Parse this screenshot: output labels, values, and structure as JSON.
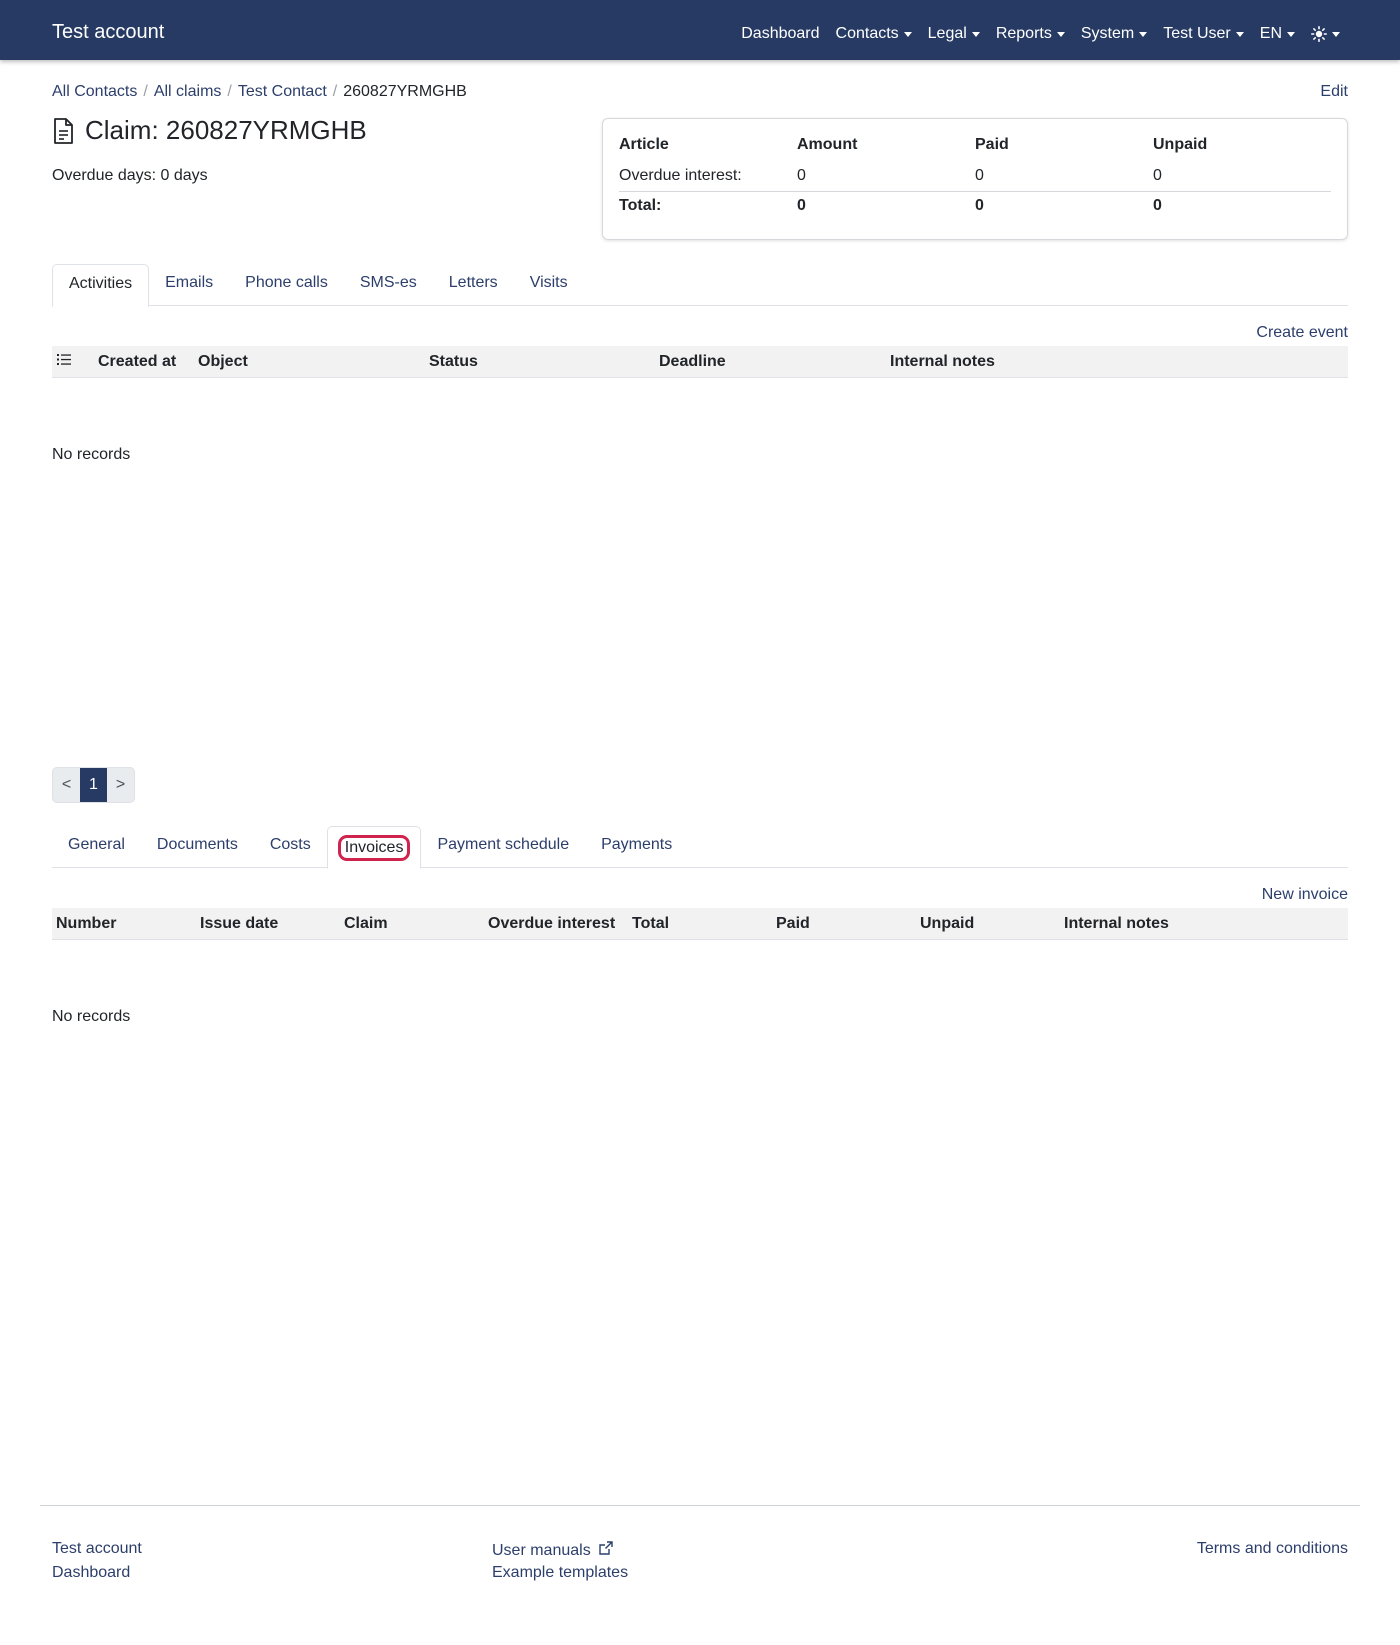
{
  "navbar": {
    "brand": "Test account",
    "items": [
      {
        "label": "Dashboard",
        "dropdown": false
      },
      {
        "label": "Contacts",
        "dropdown": true
      },
      {
        "label": "Legal",
        "dropdown": true
      },
      {
        "label": "Reports",
        "dropdown": true
      },
      {
        "label": "System",
        "dropdown": true
      },
      {
        "label": "Test User",
        "dropdown": true
      },
      {
        "label": "EN",
        "dropdown": true
      }
    ],
    "theme_icon": "sun-icon"
  },
  "breadcrumb": {
    "items": [
      "All Contacts",
      "All claims",
      "Test Contact"
    ],
    "active": "260827YRMGHB"
  },
  "edit_label": "Edit",
  "title": "Claim: 260827YRMGHB",
  "title_icon": "document-icon",
  "overdue_text": "Overdue days: 0 days",
  "summary": {
    "headers": [
      "Article",
      "Amount",
      "Paid",
      "Unpaid"
    ],
    "rows": [
      [
        "Overdue interest:",
        "0",
        "0",
        "0"
      ]
    ],
    "total": [
      "Total:",
      "0",
      "0",
      "0"
    ]
  },
  "activity_tabs": {
    "items": [
      "Activities",
      "Emails",
      "Phone calls",
      "SMS-es",
      "Letters",
      "Visits"
    ],
    "active": "Activities"
  },
  "activities": {
    "action": "Create event",
    "columns": [
      "Created at",
      "Object",
      "Status",
      "Deadline",
      "Internal notes"
    ],
    "empty": "No records",
    "list_icon": "list-icon"
  },
  "pagination": {
    "prev": "<",
    "current": "1",
    "next": ">"
  },
  "claim_tabs": {
    "items": [
      "General",
      "Documents",
      "Costs",
      "Invoices",
      "Payment schedule",
      "Payments"
    ],
    "active": "Invoices"
  },
  "invoices": {
    "action": "New invoice",
    "columns": [
      "Number",
      "Issue date",
      "Claim",
      "Overdue interest",
      "Total",
      "Paid",
      "Unpaid",
      "Internal notes"
    ],
    "empty": "No records"
  },
  "footer": {
    "left": [
      "Test account",
      "Dashboard"
    ],
    "middle": [
      "User manuals",
      "Example templates"
    ],
    "right": "Terms and conditions",
    "external_icon": "external-link-icon"
  },
  "colors": {
    "navbar": "#263a63",
    "link": "#2c3e6b",
    "highlight": "#d0244e"
  }
}
